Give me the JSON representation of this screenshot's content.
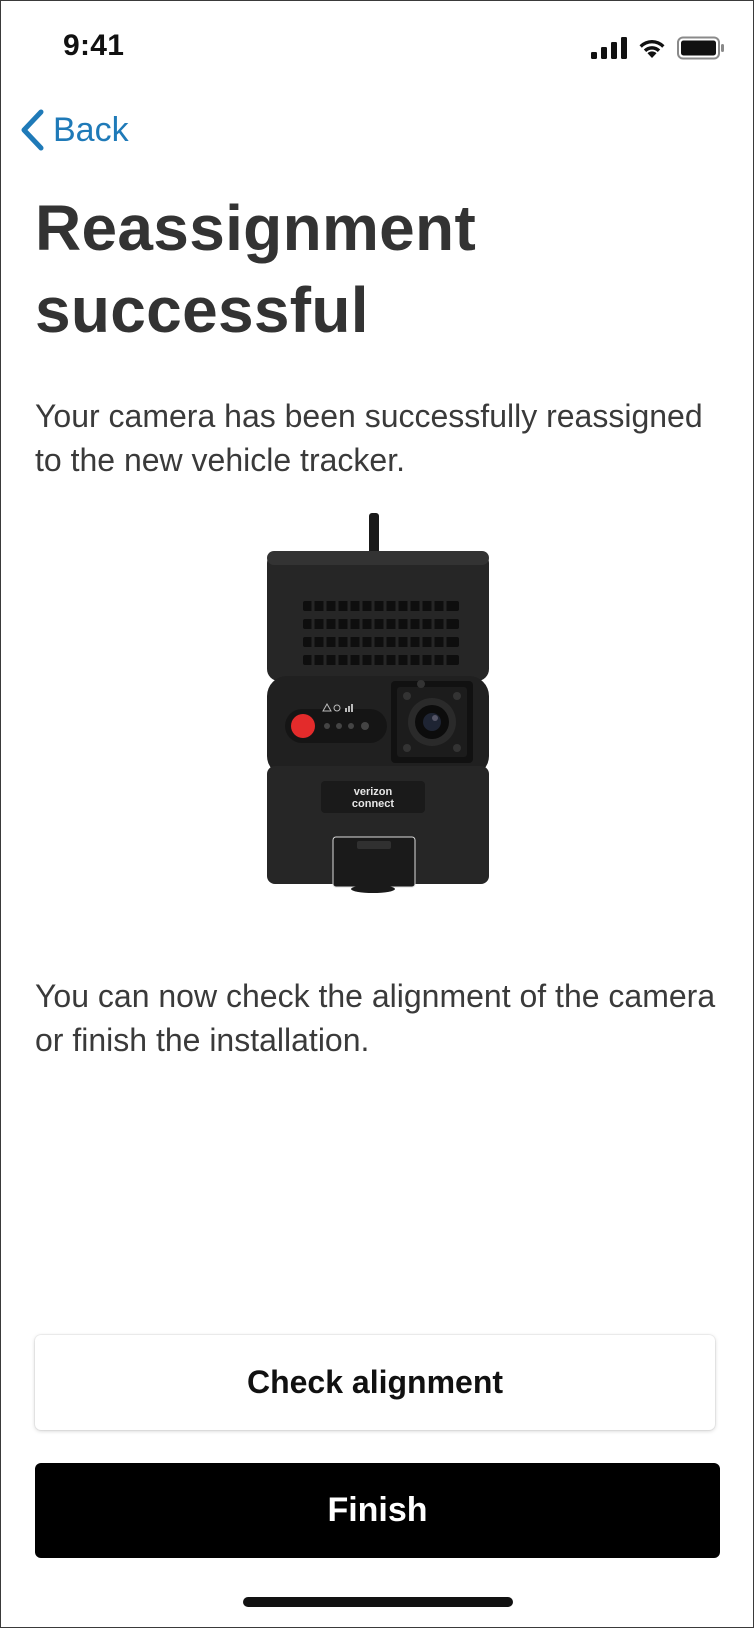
{
  "status_bar": {
    "time": "9:41",
    "icons": [
      "cellular-signal-icon",
      "wifi-icon",
      "battery-icon"
    ]
  },
  "nav": {
    "back_label": "Back",
    "back_icon": "chevron-left-icon"
  },
  "content": {
    "title_line1": "Reassignment",
    "title_line2": "successful",
    "description": "Your camera has been successfully reassigned to the new vehicle tracker.",
    "image_brand_line1": "verizon",
    "image_brand_line2": "connect",
    "instruction": "You can now check the alignment of the camera or finish the installation."
  },
  "actions": {
    "check_alignment_label": "Check alignment",
    "finish_label": "Finish"
  },
  "colors": {
    "link": "#1f7ab8",
    "primary_button": "#000000",
    "text": "#333333",
    "camera_record_button": "#e32b2b"
  }
}
